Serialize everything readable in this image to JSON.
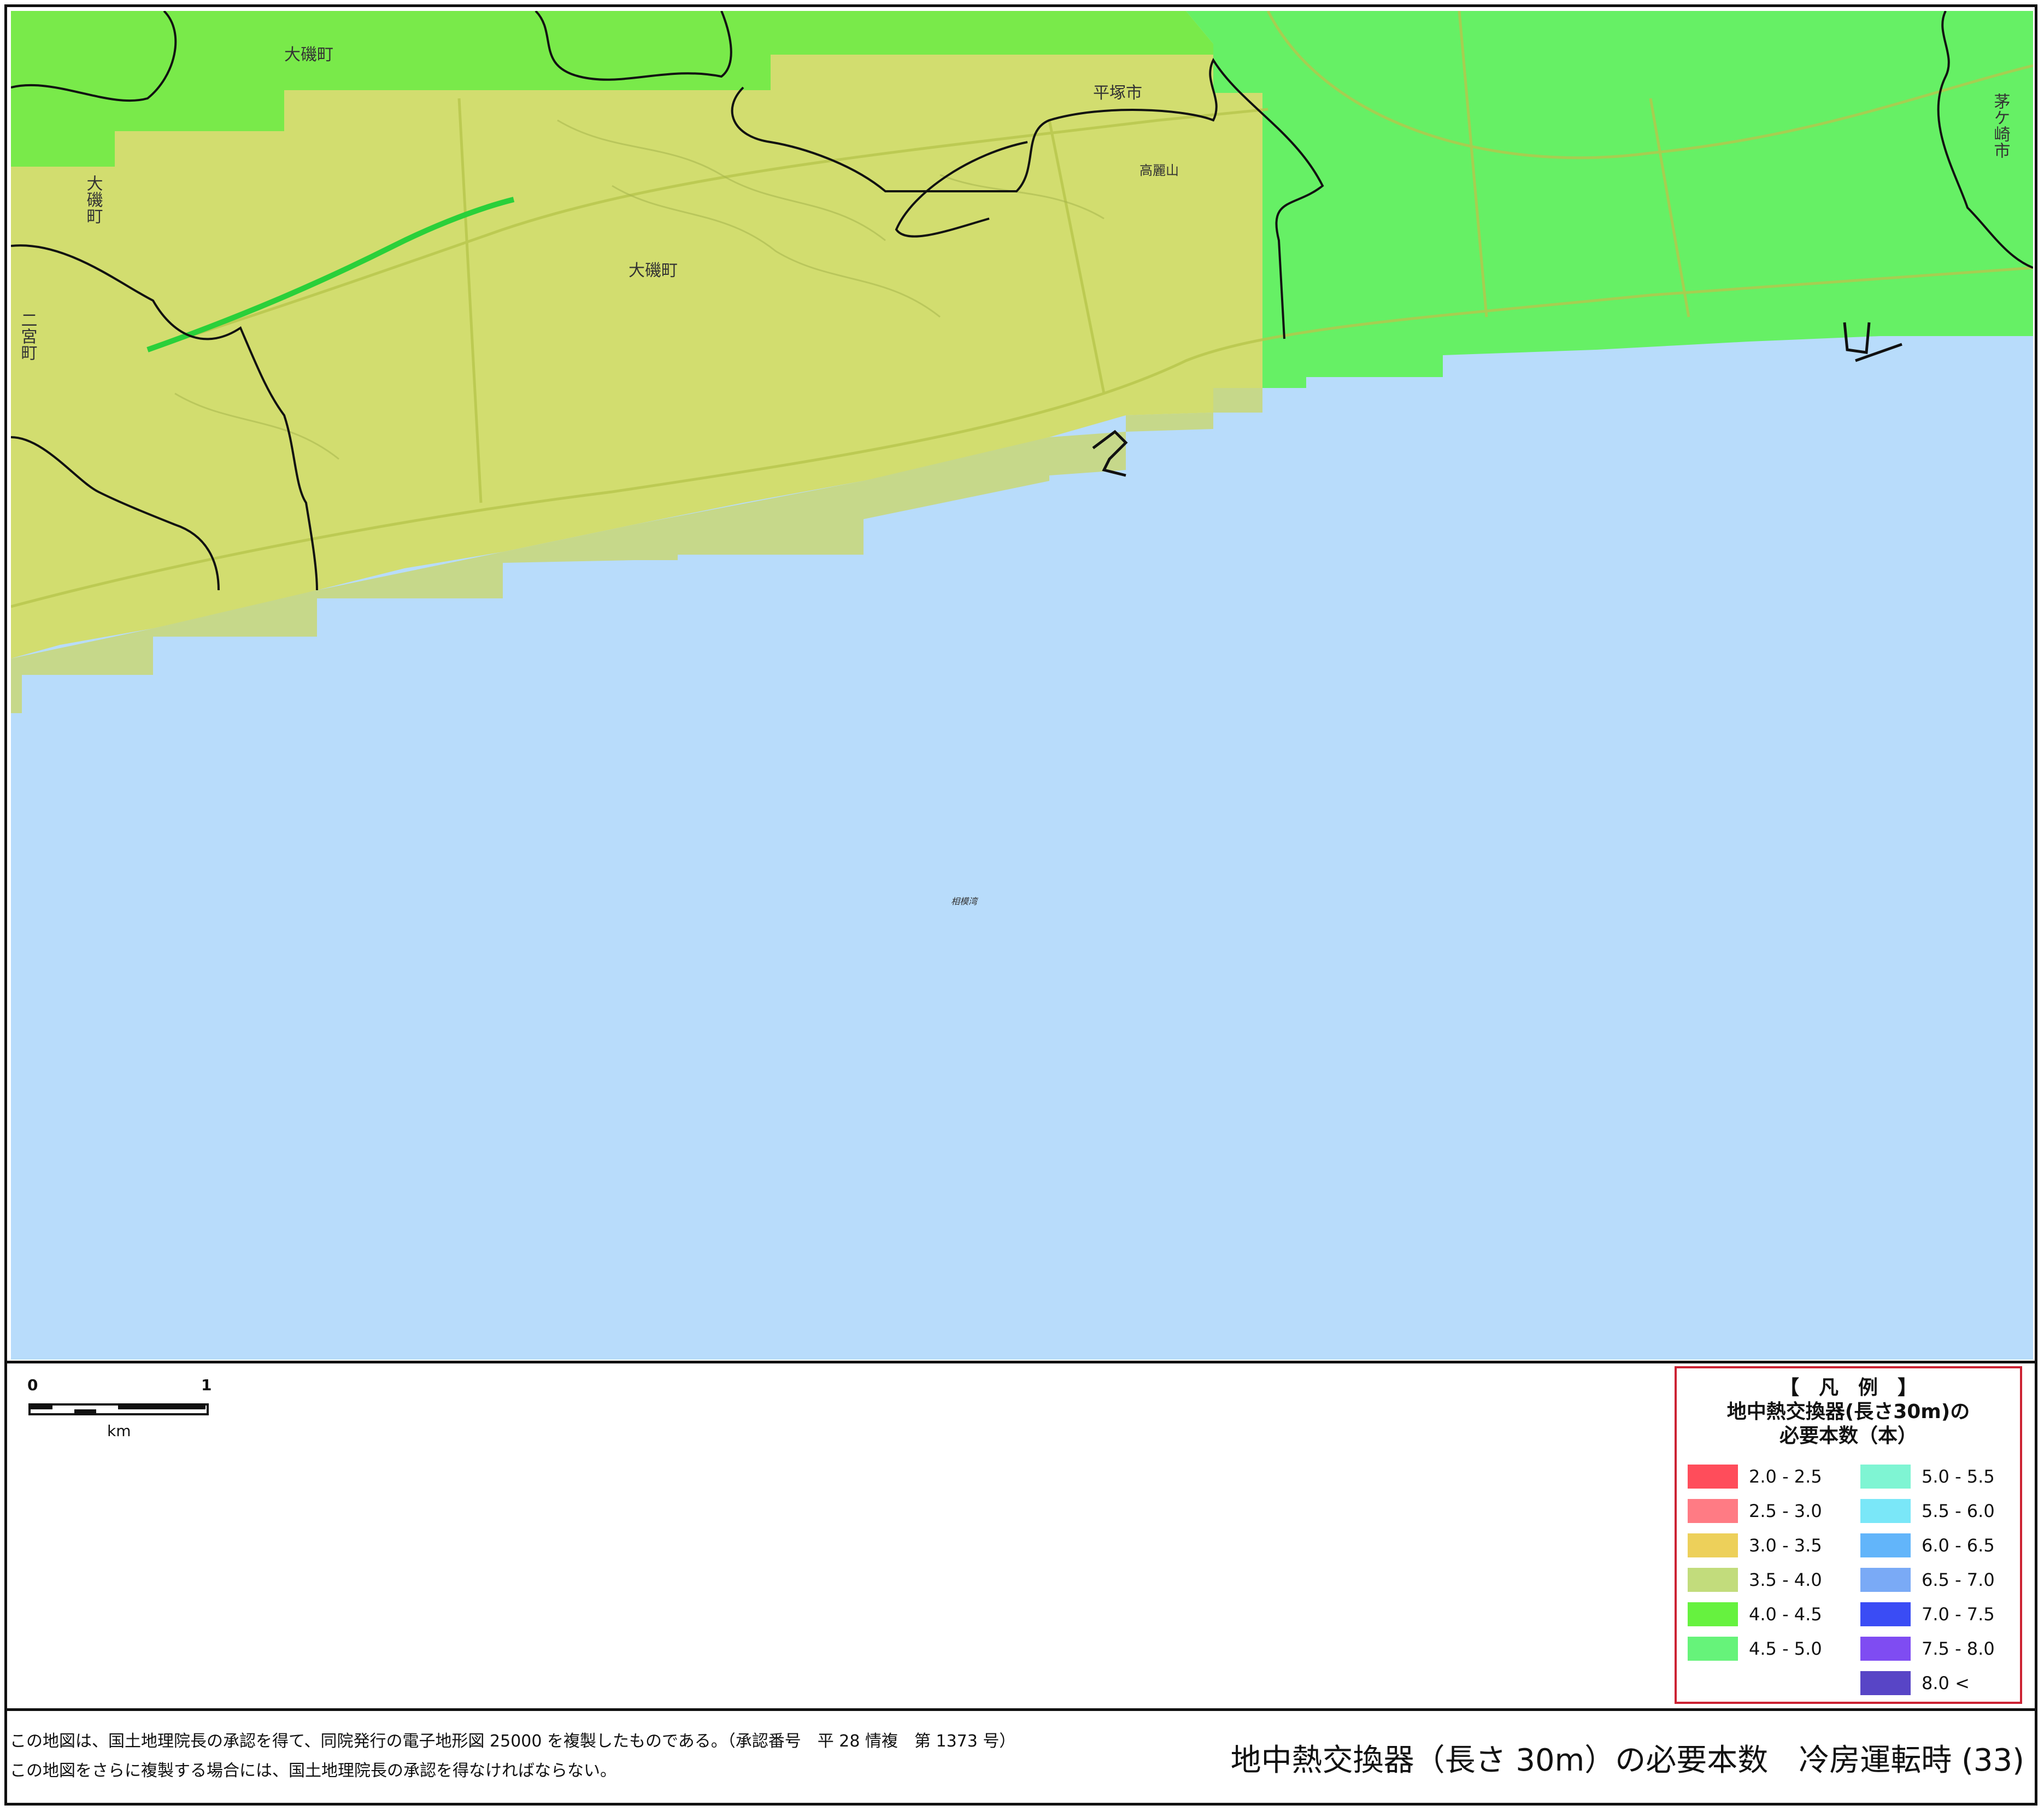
{
  "map": {
    "place_labels": [
      "大磯町",
      "大磯町",
      "平塚市",
      "茅ケ崎市",
      "大磯町",
      "二宮町",
      "高麗山",
      "相模湾"
    ],
    "sea_color": "#b8dcfb",
    "zone_colors": {
      "band_3_5_4_0": "#c8d77a",
      "band_3_0_3_5": "#d7de6c",
      "band_4_0_4_5": "#76ee50",
      "band_4_5_5_0": "#66f065"
    }
  },
  "scalebar": {
    "start": "0",
    "end": "1",
    "unit": "km"
  },
  "legend": {
    "bracket_title": "【　凡　例　】",
    "line1": "地中熱交換器(長さ30m)の",
    "line2": "必要本数（本）",
    "left_items": [
      {
        "range": "2.0 - 2.5",
        "color": "#ff4d5b"
      },
      {
        "range": "2.5 - 3.0",
        "color": "#ff7b84"
      },
      {
        "range": "3.0 - 3.5",
        "color": "#edd05a"
      },
      {
        "range": "3.5 - 4.0",
        "color": "#c2dc7c"
      },
      {
        "range": "4.0 - 4.5",
        "color": "#66f23f"
      },
      {
        "range": "4.5 - 5.0",
        "color": "#66f37a"
      }
    ],
    "right_items": [
      {
        "range": "5.0 - 5.5",
        "color": "#7ff5d3"
      },
      {
        "range": "5.5 - 6.0",
        "color": "#7ae7f8"
      },
      {
        "range": "6.0 - 6.5",
        "color": "#62b5fa"
      },
      {
        "range": "6.5 - 7.0",
        "color": "#7aaaf6"
      },
      {
        "range": "7.0 - 7.5",
        "color": "#3a4cf5"
      },
      {
        "range": "7.5 - 8.0",
        "color": "#7f4cf2"
      },
      {
        "range": "8.0 <",
        "color": "#5845c6"
      }
    ]
  },
  "footer": {
    "note1": "この地図は、国土地理院長の承認を得て、同院発行の電子地形図 25000 を複製したものである。（承認番号　平 28 情複　第 1373 号）",
    "note2": "この地図をさらに複製する場合には、国土地理院長の承認を得なければならない。",
    "title": "地中熱交換器（長さ 30m）の必要本数　冷房運転時 (33)"
  }
}
